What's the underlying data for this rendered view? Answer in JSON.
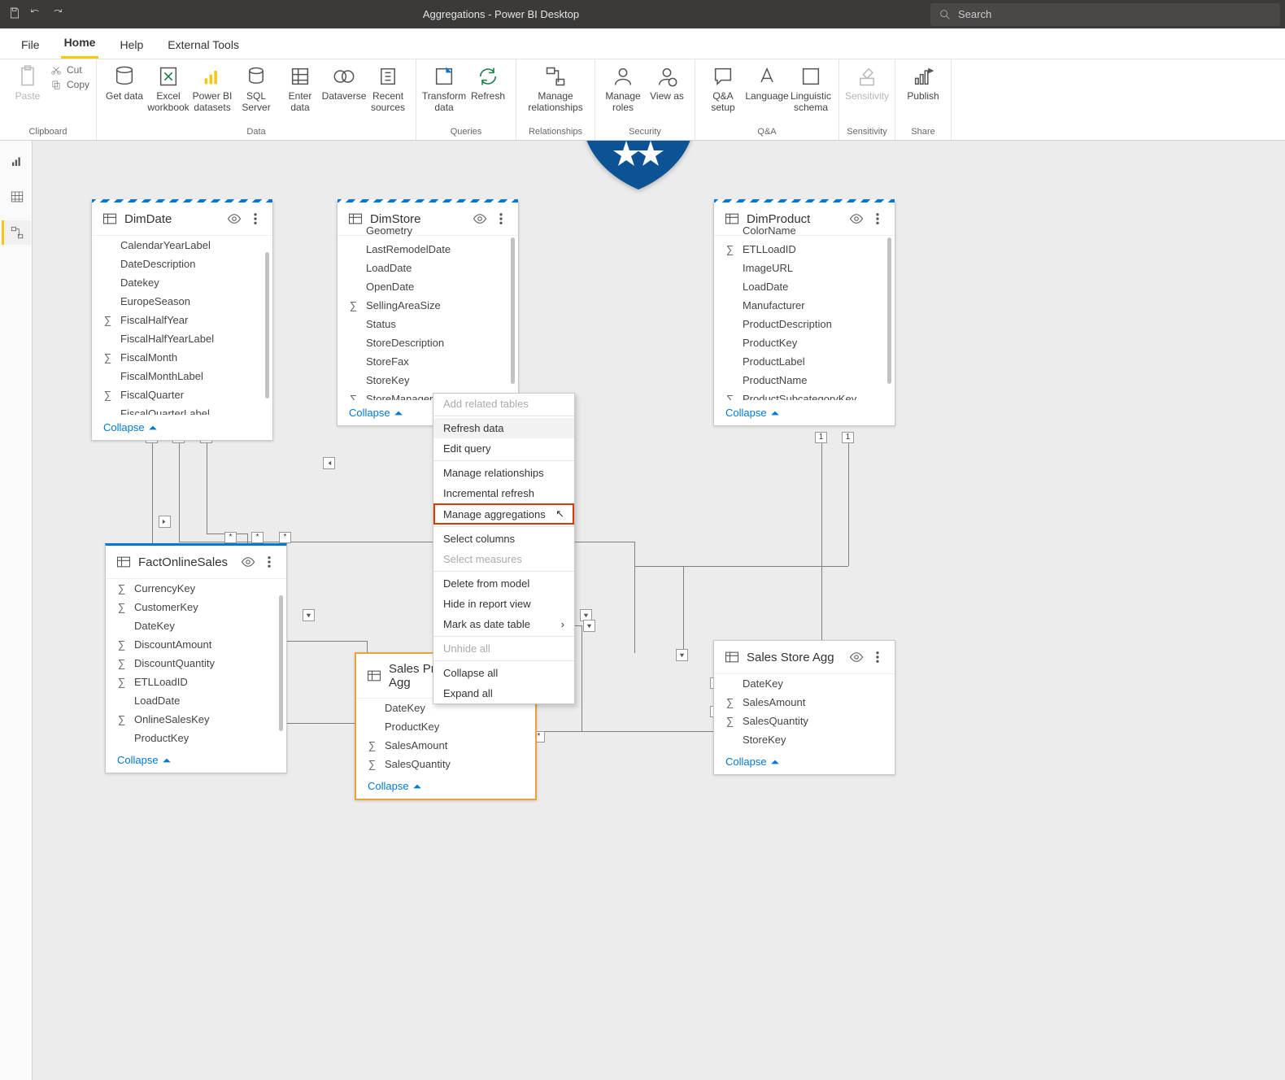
{
  "app": {
    "title": "Aggregations - Power BI Desktop",
    "search_placeholder": "Search"
  },
  "tabs": {
    "file": "File",
    "home": "Home",
    "help": "Help",
    "ext": "External Tools"
  },
  "ribbon": {
    "clipboard": {
      "label": "Clipboard",
      "paste": "Paste",
      "cut": "Cut",
      "copy": "Copy"
    },
    "data": {
      "label": "Data",
      "get": "Get data",
      "excel": "Excel workbook",
      "pbids": "Power BI datasets",
      "sql": "SQL Server",
      "enter": "Enter data",
      "dv": "Dataverse",
      "recent": "Recent sources"
    },
    "queries": {
      "label": "Queries",
      "transform": "Transform data",
      "refresh": "Refresh"
    },
    "rel": {
      "label": "Relationships",
      "manage": "Manage relationships"
    },
    "security": {
      "label": "Security",
      "roles": "Manage roles",
      "viewas": "View as"
    },
    "qa": {
      "label": "Q&A",
      "setup": "Q&A setup",
      "lang": "Language",
      "ling": "Linguistic schema"
    },
    "sens": {
      "label": "Sensitivity",
      "btn": "Sensitivity"
    },
    "share": {
      "label": "Share",
      "btn": "Publish"
    }
  },
  "cards": {
    "dimdate": {
      "name": "DimDate",
      "collapse": "Collapse",
      "fields": [
        "CalendarYearLabel",
        "DateDescription",
        "Datekey",
        "EuropeSeason",
        "FiscalHalfYear",
        "FiscalHalfYearLabel",
        "FiscalMonth",
        "FiscalMonthLabel",
        "FiscalQuarter",
        "FiscalQuarterLabel"
      ],
      "sigma": [
        4,
        6,
        8
      ]
    },
    "dimstore": {
      "name": "DimStore",
      "collapse": "Collapse",
      "fields": [
        "Geometry",
        "LastRemodelDate",
        "LoadDate",
        "OpenDate",
        "SellingAreaSize",
        "Status",
        "StoreDescription",
        "StoreFax",
        "StoreKey",
        "StoreManager"
      ],
      "sigma": [
        4,
        9
      ]
    },
    "dimproduct": {
      "name": "DimProduct",
      "collapse": "Collapse",
      "fields": [
        "ColorName",
        "ETLLoadID",
        "ImageURL",
        "LoadDate",
        "Manufacturer",
        "ProductDescription",
        "ProductKey",
        "ProductLabel",
        "ProductName",
        "ProductSubcategoryKey"
      ],
      "sigma": [
        1,
        9
      ]
    },
    "fact": {
      "name": "FactOnlineSales",
      "collapse": "Collapse",
      "fields": [
        "CurrencyKey",
        "CustomerKey",
        "DateKey",
        "DiscountAmount",
        "DiscountQuantity",
        "ETLLoadID",
        "LoadDate",
        "OnlineSalesKey",
        "ProductKey"
      ],
      "sigma": [
        0,
        1,
        3,
        4,
        5,
        7
      ]
    },
    "spagg": {
      "name": "Sales Product Agg",
      "collapse": "Collapse",
      "fields": [
        "DateKey",
        "ProductKey",
        "SalesAmount",
        "SalesQuantity"
      ],
      "sigma": [
        2,
        3
      ]
    },
    "ssagg": {
      "name": "Sales Store Agg",
      "collapse": "Collapse",
      "fields": [
        "DateKey",
        "SalesAmount",
        "SalesQuantity",
        "StoreKey"
      ],
      "sigma": [
        1,
        2
      ]
    }
  },
  "ctx": {
    "items": [
      "Add related tables",
      "Refresh data",
      "Edit query",
      "Manage relationships",
      "Incremental refresh",
      "Manage aggregations",
      "Select columns",
      "Select measures",
      "Delete from model",
      "Hide in report view",
      "Mark as date table",
      "Unhide all",
      "Collapse all",
      "Expand all"
    ]
  }
}
